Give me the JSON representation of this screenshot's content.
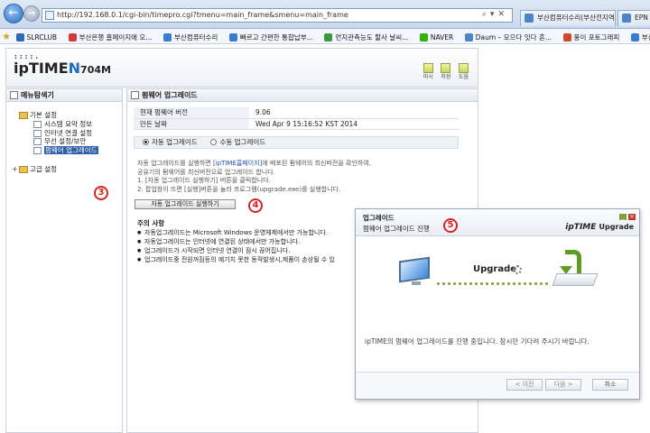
{
  "browser": {
    "url": "http://192.168.0.1/cgi-bin/timepro.cgi?tmenu=main_frame&smenu=main_frame",
    "tabs": [
      {
        "label": "부산컴퓨터수리(부산전지역)"
      },
      {
        "label": "EPN"
      }
    ],
    "favorites": [
      {
        "label": "SLRCLUB",
        "color": "#2c6bb5"
      },
      {
        "label": "부산은행 홈페이지에 오...",
        "color": "#d23b3b"
      },
      {
        "label": "부산컴퓨터수리",
        "color": "#3a7bd5"
      },
      {
        "label": "빠르고 간편한 통합납부...",
        "color": "#3a7bd5"
      },
      {
        "label": "먼지관측능도 할사 날씨...",
        "color": "#3a9a3a"
      },
      {
        "label": "NAVER",
        "color": "#2db400"
      },
      {
        "label": "Daum – 모으다 잇다 흔...",
        "color": "#4a86c8"
      },
      {
        "label": "풍이 포토그래피",
        "color": "#d24a2a"
      },
      {
        "label": "부산컴퓨터수리",
        "color": "#3a7bd5"
      }
    ]
  },
  "header": {
    "logo_dots": "::::.",
    "brand": "ipTIME",
    "model_letter": "N",
    "model": "704M",
    "icons": [
      {
        "label": "마시"
      },
      {
        "label": "저장"
      },
      {
        "label": "도움"
      }
    ]
  },
  "sidebar": {
    "title": "메뉴탐색기",
    "sections": [
      {
        "label": "기본 설정",
        "items": [
          {
            "label": "시스템 요약 정보"
          },
          {
            "label": "인터넷 연결 설정"
          },
          {
            "label": "무선 설정/보안"
          },
          {
            "label": "펌웨어 업그레이드"
          }
        ]
      },
      {
        "label": "고급 설정"
      }
    ],
    "step_badge": "3"
  },
  "main": {
    "title": "펌웨어 업그레이드",
    "info": [
      {
        "key": "현재 펌웨어 버전",
        "value": "9.06"
      },
      {
        "key": "만든 날짜",
        "value": "Wed Apr 9 15:16:52 KST 2014"
      }
    ],
    "radio_auto": "자동 업그레이드",
    "radio_manual": "수동 업그레이드",
    "desc_line1_pre": "자동 업그레이드를 실행하면 ",
    "desc_link": "[ipTIME홈페이지]",
    "desc_line1_post": "에 배포된 펌웨어의 최신버전을 확인하여,",
    "desc_line2": "공유기의 펌웨어를 최신버전으로 업그레이드 합니다.",
    "desc_line3": "1. [자동 업그레이드 실행하기] 버튼을 클릭합니다.",
    "desc_line4": "2. 팝업창이 뜨면 [실행]버튼을 눌러 프로그램(upgrade.exe)를 실행합니다.",
    "run_button": "자동 업그레이드 실행하기",
    "step_badge": "4",
    "notes_title": "주의 사항",
    "notes": [
      "자동업그레이드는 Microsoft Windows 운영체제에서만 가능합니다.",
      "자동업그레이드는 인터넷에 연결된 상태에서만 가능합니다.",
      "업그레이드가 시작되면 인터넷 연결이 잠시 끊어집니다.",
      "업그레이드중 전원꺼짐등의 예기치 못한 동작발생시,제품이 손상될 수 있"
    ]
  },
  "dialog": {
    "title": "업그레이드",
    "subtitle": "펌웨어 업그레이드 진행",
    "logo_brand": "ipTIME",
    "logo_word": "Upgrade",
    "step_badge": "5",
    "status_label": "Upgrade",
    "message": "ipTIME의 펌웨어 업그레이드를 진행 중입니다. 잠시만 기다려 주시기 바랍니다.",
    "buttons": {
      "prev": "< 이전",
      "next": "다음 >",
      "cancel": "취소"
    }
  }
}
